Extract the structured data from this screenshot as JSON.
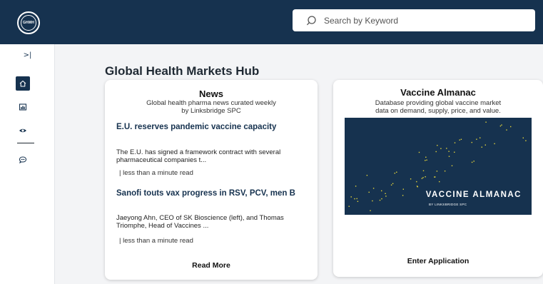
{
  "header": {
    "logo_text": "GHMH",
    "search": {
      "placeholder": "Search by Keyword"
    }
  },
  "sidebar": {
    "toggle_label": ">|",
    "items": [
      {
        "icon": "home-icon",
        "active": true
      },
      {
        "icon": "chart-icon",
        "active": false
      },
      {
        "icon": "eye-icon",
        "active": false
      },
      {
        "icon": "chat-icon",
        "active": false
      }
    ]
  },
  "main": {
    "title": "Global Health Markets Hub",
    "news": {
      "title": "News",
      "subtitle_line1": "Global health pharma news curated weekly",
      "subtitle_line2": "by Linksbridge SPC",
      "articles": [
        {
          "title": "E.U. reserves pandemic vaccine capacity",
          "snippet": "The E.U. has signed a framework contract with several pharmaceutical companies t...",
          "meta": "| less than a minute read"
        },
        {
          "title": "Sanofi touts vax progress in RSV, PCV, men B",
          "snippet": "Jaeyong Ahn, CEO of SK Bioscience (left), and Thomas Triomphe, Head of Vaccines ...",
          "meta": "| less than a minute read"
        }
      ],
      "read_more": "Read More"
    },
    "vaccine": {
      "title": "Vaccine Almanac",
      "subtitle_line1": "Database providing global vaccine market",
      "subtitle_line2": "data on demand, supply, price, and value.",
      "image_title": "VACCINE ALMANAC",
      "image_subtitle": "BY LINKSBRIDGE SPC",
      "enter": "Enter Application"
    }
  },
  "colors": {
    "navy": "#16324f",
    "dot": "#e4d43a",
    "background": "#f3f4f6"
  }
}
